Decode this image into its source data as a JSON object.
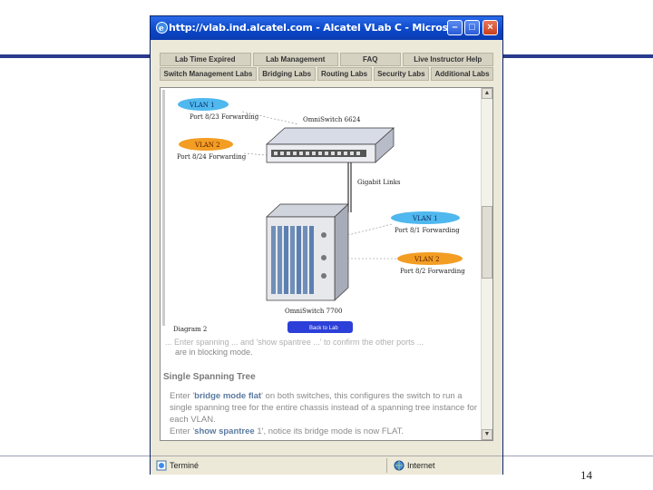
{
  "window": {
    "title": "http://vlab.ind.alcatel.com - Alcatel VLab C - Microsoft Internet E...",
    "minimize_glyph": "–",
    "maximize_glyph": "□",
    "close_glyph": "×"
  },
  "nav": {
    "row1": [
      "Lab Time Expired",
      "Lab Management",
      "FAQ",
      "Live Instructor Help"
    ],
    "row2": [
      "Switch Management Labs",
      "Bridging Labs",
      "Routing Labs",
      "Security Labs",
      "Additional Labs"
    ]
  },
  "diagram": {
    "vlan_top_1": "VLAN 1",
    "vlan_top_1_port": "Port 8/23 Forwarding",
    "vlan_top_2": "VLAN 2",
    "vlan_top_2_port": "Port 8/24 Forwarding",
    "switch_top": "OmniSwitch 6624",
    "gigabit": "Gigabit Links",
    "vlan_bottom_1": "VLAN 1",
    "vlan_bottom_1_port": "Port 8/1 Forwarding",
    "vlan_bottom_2": "VLAN 2",
    "vlan_bottom_2_port": "Port 8/2 Forwarding",
    "switch_bottom": "OmniSwitch 7700",
    "caption": "Diagram    2",
    "button_label": "Back to Lab"
  },
  "content": {
    "partial_line": "... Enter spanning ... and 'show spantree ...' to confirm the other ports ...",
    "blocking_line": "are in blocking mode.",
    "section_heading": "Single Spanning Tree",
    "para1_prefix": "Enter '",
    "para1_cmd": "bridge mode flat",
    "para1_suffix": "' on both switches, this configures the switch to run a single spanning tree for the entire chassis instead of a spanning tree instance for each VLAN.",
    "para2_prefix": "Enter '",
    "para2_cmd": "show spantree",
    "para2_suffix": " 1', notice its bridge mode is now FLAT."
  },
  "status": {
    "left": "Terminé",
    "right": "Internet"
  },
  "slide": {
    "page_number": "14"
  }
}
